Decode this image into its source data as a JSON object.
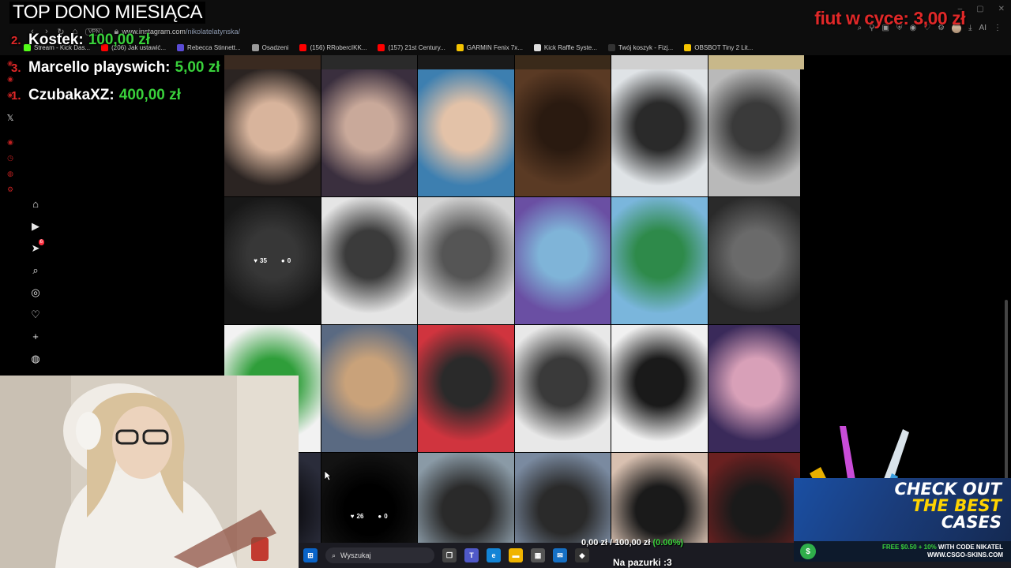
{
  "overlay": {
    "top_title": "TOP DONO MIESIĄCA",
    "donors": [
      {
        "rank": "2.",
        "name": "Kostek:",
        "amount": "100,00 zł"
      },
      {
        "rank": "3.",
        "name": "Marcello playswich:",
        "amount": "5,00 zł"
      },
      {
        "rank": "1.",
        "name": "CzubakaXZ:",
        "amount": "400,00 zł"
      }
    ],
    "goal_label": "fiut w cyce:",
    "goal_amount": "3,00 zł",
    "sub_goal_text": "0,00 zł / 100,00 zł",
    "sub_goal_pct": "(0.00%)",
    "footer_text": "Na pazurki :3"
  },
  "browser": {
    "vpn": "VPN",
    "url_host": "www.instagram.com",
    "url_path": "/nikolatelatynska/",
    "bookmarks": [
      {
        "label": "Stream - Kick Das...",
        "color": "#53fc18"
      },
      {
        "label": "(206) Jak ustawić...",
        "color": "#ff0000"
      },
      {
        "label": "Rebecca Stinnett...",
        "color": "#5b4cd6"
      },
      {
        "label": "Osadzeni",
        "color": "#999999"
      },
      {
        "label": "(156) RRobercIKK...",
        "color": "#ff0000"
      },
      {
        "label": "(157) 21st Century...",
        "color": "#ff0000"
      },
      {
        "label": "GARMIN Fenix 7x...",
        "color": "#f5c400"
      },
      {
        "label": "Kick Raffle Syste...",
        "color": "#dddddd"
      },
      {
        "label": "Twój koszyk - Fizj...",
        "color": "#333333"
      },
      {
        "label": "OBSBOT Tiny 2 Lit...",
        "color": "#f5c400"
      }
    ],
    "ai_label": "AI"
  },
  "posts": [
    {
      "likes": "35",
      "comments": "0"
    },
    {
      "likes": "26",
      "comments": "0"
    }
  ],
  "taskbar": {
    "search_placeholder": "Wyszukaj"
  },
  "ad": {
    "line1": "CHECK OUT",
    "line2": "THE BEST",
    "line3": "CASES",
    "promo_line1_a": "FREE $0.50 + 10%",
    "promo_line1_b": " WITH CODE NIKATEL",
    "promo_line2": "WWW.CSGO-SKINS.COM"
  },
  "colors": {
    "accent_red": "#e02828",
    "accent_green": "#39d13b",
    "ad_yellow": "#ffd400"
  }
}
